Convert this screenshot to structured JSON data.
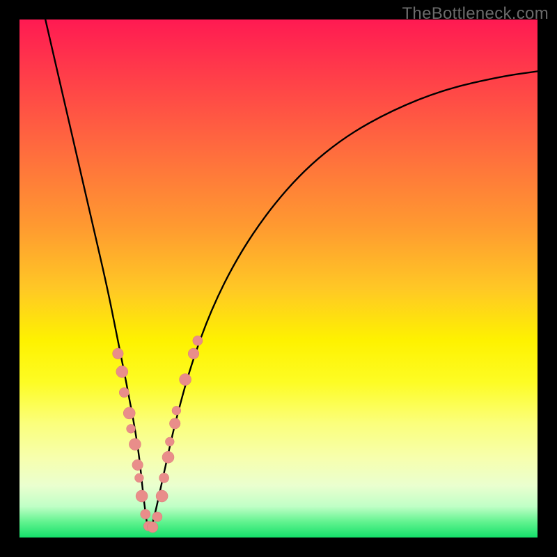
{
  "watermark": "TheBottleneck.com",
  "colors": {
    "frame": "#000000",
    "curve": "#000000",
    "marker_fill": "#e98d8a",
    "marker_stroke": "#d87b78"
  },
  "chart_data": {
    "type": "line",
    "title": "",
    "xlabel": "",
    "ylabel": "",
    "xlim": [
      0,
      100
    ],
    "ylim": [
      0,
      100
    ],
    "grid": false,
    "legend": false,
    "note": "V-shaped bottleneck curve; values estimated from shape (vertex ≈ x=25, y=0). Markers cluster along both arms near the vertex in the lower colored band.",
    "series": [
      {
        "name": "bottleneck-curve",
        "x": [
          5,
          8,
          11,
          14,
          17,
          19,
          21,
          23,
          24,
          25,
          26.5,
          28,
          30,
          33,
          37,
          42,
          48,
          55,
          63,
          72,
          82,
          93,
          100
        ],
        "y": [
          100,
          87,
          74,
          61,
          48,
          38,
          28,
          17,
          7,
          0,
          6,
          13,
          22,
          33,
          44,
          54,
          63,
          71,
          77.5,
          82.5,
          86.5,
          89,
          90
        ]
      }
    ],
    "markers": [
      {
        "x": 19.0,
        "y": 35.5,
        "r": 1.1
      },
      {
        "x": 19.8,
        "y": 32.0,
        "r": 1.2
      },
      {
        "x": 20.2,
        "y": 28.0,
        "r": 1.0
      },
      {
        "x": 21.2,
        "y": 24.0,
        "r": 1.2
      },
      {
        "x": 21.5,
        "y": 21.0,
        "r": 0.9
      },
      {
        "x": 22.3,
        "y": 18.0,
        "r": 1.2
      },
      {
        "x": 22.8,
        "y": 14.0,
        "r": 1.1
      },
      {
        "x": 23.1,
        "y": 11.5,
        "r": 0.9
      },
      {
        "x": 23.6,
        "y": 8.0,
        "r": 1.2
      },
      {
        "x": 24.3,
        "y": 4.5,
        "r": 1.0
      },
      {
        "x": 24.9,
        "y": 2.2,
        "r": 1.0
      },
      {
        "x": 25.7,
        "y": 2.0,
        "r": 1.1
      },
      {
        "x": 26.6,
        "y": 4.0,
        "r": 1.0
      },
      {
        "x": 27.5,
        "y": 8.0,
        "r": 1.2
      },
      {
        "x": 27.9,
        "y": 11.5,
        "r": 1.0
      },
      {
        "x": 28.7,
        "y": 15.5,
        "r": 1.2
      },
      {
        "x": 29.0,
        "y": 18.5,
        "r": 0.9
      },
      {
        "x": 30.0,
        "y": 22.0,
        "r": 1.1
      },
      {
        "x": 30.3,
        "y": 24.5,
        "r": 0.9
      },
      {
        "x": 32.0,
        "y": 30.5,
        "r": 1.2
      },
      {
        "x": 33.6,
        "y": 35.5,
        "r": 1.1
      },
      {
        "x": 34.4,
        "y": 38.0,
        "r": 1.0
      }
    ]
  }
}
